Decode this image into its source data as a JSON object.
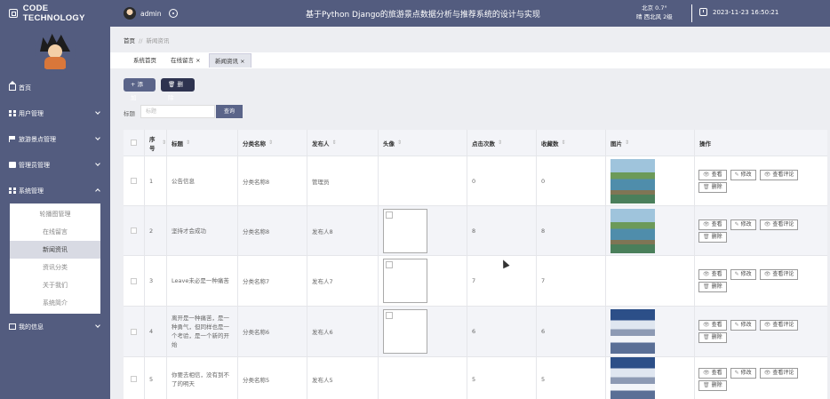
{
  "header": {
    "brand": "CODE TECHNOLOGY",
    "user_name": "admin",
    "title": "基于Python Django的旅游景点数据分析与推荐系统的设计与实现",
    "weather_line1": "北京 0.7°",
    "weather_line2": "晴 西北风 2级",
    "datetime": "2023-11-23 16:50:21"
  },
  "sidebar": {
    "items": [
      {
        "label": "首页",
        "icon": "home-icon"
      },
      {
        "label": "用户管理",
        "icon": "grid-icon"
      },
      {
        "label": "旅游景点管理",
        "icon": "flag-icon"
      },
      {
        "label": "管理员管理",
        "icon": "box-icon"
      },
      {
        "label": "系统管理",
        "icon": "grid-icon"
      },
      {
        "label": "我的信息",
        "icon": "message-icon"
      }
    ],
    "submenu": [
      "轮播图管理",
      "在线留言",
      "新闻资讯",
      "资讯分类",
      "关于我们",
      "系统简介"
    ],
    "active_sub": "新闻资讯"
  },
  "breadcrumb": {
    "home": "首页",
    "sep": "//",
    "current": "新闻资讯"
  },
  "tabs": [
    {
      "label": "系统首页"
    },
    {
      "label": "在线留言 ×"
    },
    {
      "label": "新闻资讯 ×"
    }
  ],
  "toolbar": {
    "add_label": "+ 添加",
    "delete_label": "🗑 删除"
  },
  "search": {
    "label": "标题",
    "placeholder": "标题",
    "button": "查询"
  },
  "table": {
    "headers": [
      "序号",
      "标题",
      "分类名称",
      "发布人",
      "头像",
      "点击次数",
      "收藏数",
      "图片",
      "操作"
    ],
    "rows": [
      {
        "no": "1",
        "title": "公告信息",
        "category": "分类名称8",
        "publisher": "管理员",
        "clicks": "0",
        "favorites": "0",
        "avatar": false,
        "pic": "lake"
      },
      {
        "no": "2",
        "title": "坚持才会成功",
        "category": "分类名称8",
        "publisher": "发布人8",
        "clicks": "8",
        "favorites": "8",
        "avatar": true,
        "pic": "lake"
      },
      {
        "no": "3",
        "title": "Leave未必是一种痛苦",
        "category": "分类名称7",
        "publisher": "发布人7",
        "clicks": "7",
        "favorites": "7",
        "avatar": true,
        "pic": "none"
      },
      {
        "no": "4",
        "title": "离开是一种痛苦，是一种勇气，但同样也是一个考验，是一个新的开始",
        "category": "分类名称6",
        "publisher": "发布人6",
        "clicks": "6",
        "favorites": "6",
        "avatar": true,
        "pic": "snow"
      },
      {
        "no": "5",
        "title": "你要去相信，没有到不了的明天",
        "category": "分类名称5",
        "publisher": "发布人5",
        "clicks": "5",
        "favorites": "5",
        "avatar": false,
        "pic": "snow"
      }
    ],
    "actions": {
      "view": "查看",
      "edit": "修改",
      "comments": "查看评论",
      "delete": "删除"
    }
  }
}
